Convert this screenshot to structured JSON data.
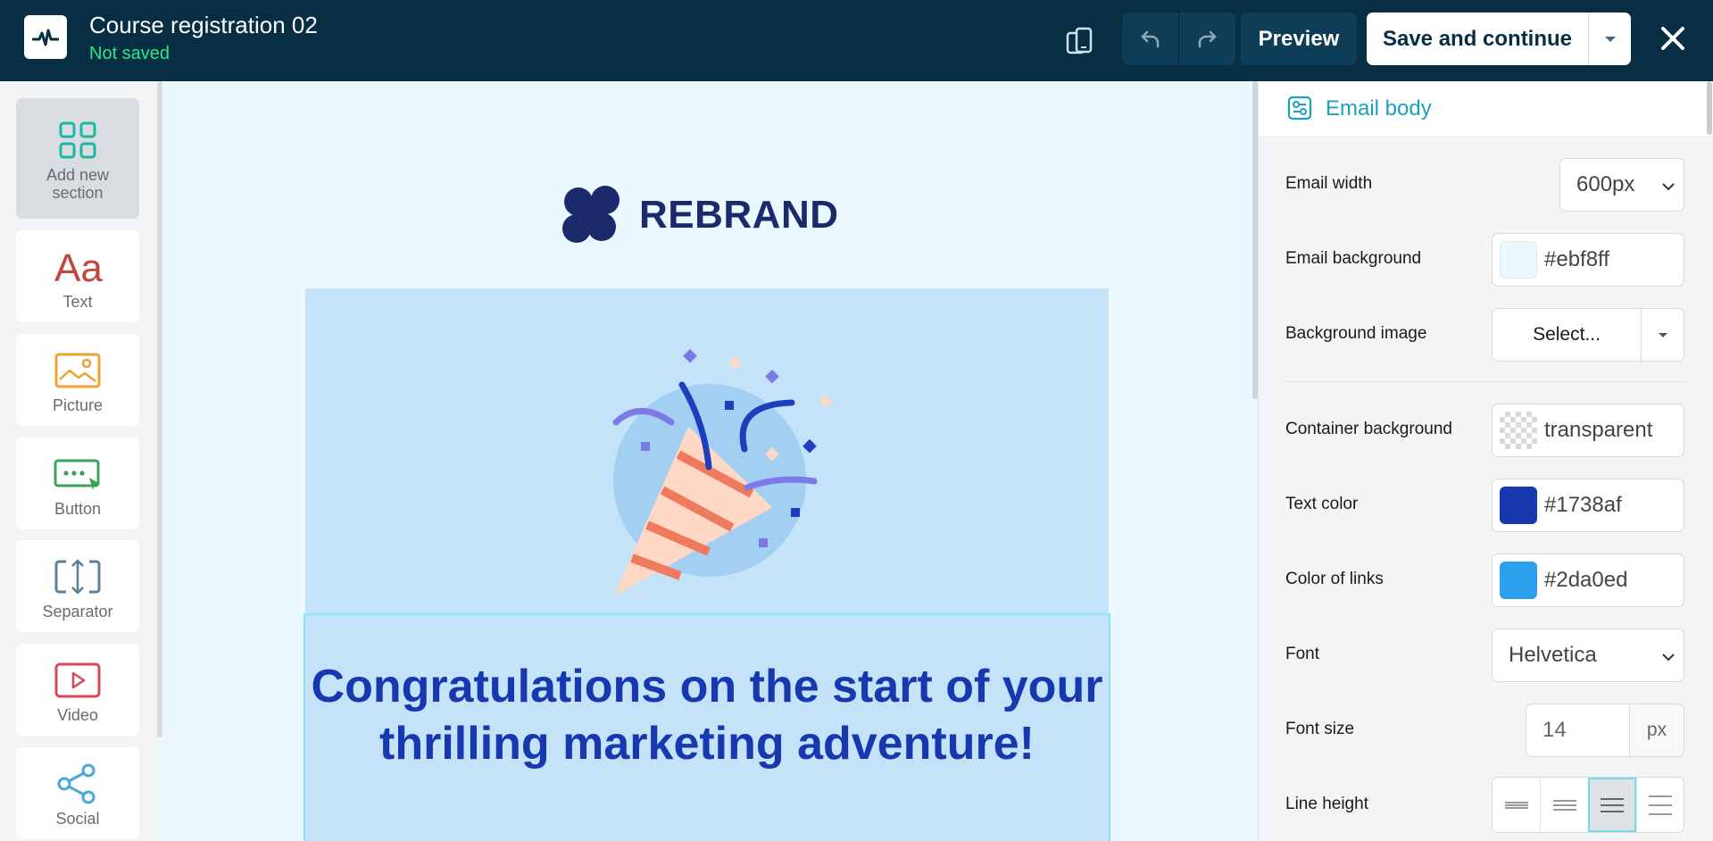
{
  "header": {
    "title": "Course registration 02",
    "status": "Not saved",
    "preview_label": "Preview",
    "save_label": "Save and continue"
  },
  "sidebar": {
    "items": [
      {
        "label": "Add new section",
        "icon": "grid-icon"
      },
      {
        "label": "Text",
        "icon": "text-icon"
      },
      {
        "label": "Picture",
        "icon": "picture-icon"
      },
      {
        "label": "Button",
        "icon": "button-icon"
      },
      {
        "label": "Separator",
        "icon": "separator-icon"
      },
      {
        "label": "Video",
        "icon": "video-icon"
      },
      {
        "label": "Social",
        "icon": "share-icon"
      }
    ]
  },
  "canvas": {
    "brand": "REBRAND",
    "headline": "Congratulations on the start of your thrilling marketing adventure!"
  },
  "panel": {
    "title": "Email body",
    "email_width_label": "Email width",
    "email_width_value": "600px",
    "email_background_label": "Email background",
    "email_background_value": "#ebf8ff",
    "background_image_label": "Background image",
    "background_image_value": "Select...",
    "container_background_label": "Container background",
    "container_background_value": "transparent",
    "text_color_label": "Text color",
    "text_color_value": "#1738af",
    "link_color_label": "Color of links",
    "link_color_value": "#2da0ed",
    "font_label": "Font",
    "font_value": "Helvetica",
    "font_size_label": "Font size",
    "font_size_value": "14",
    "font_size_unit": "px",
    "line_height_label": "Line height"
  },
  "colors": {
    "topbar": "#082e44",
    "accent": "#1d9fbf",
    "status_green": "#2ee58a",
    "text_color": "#1738af",
    "link_color": "#2da0ed",
    "email_bg": "#ebf8ff"
  }
}
